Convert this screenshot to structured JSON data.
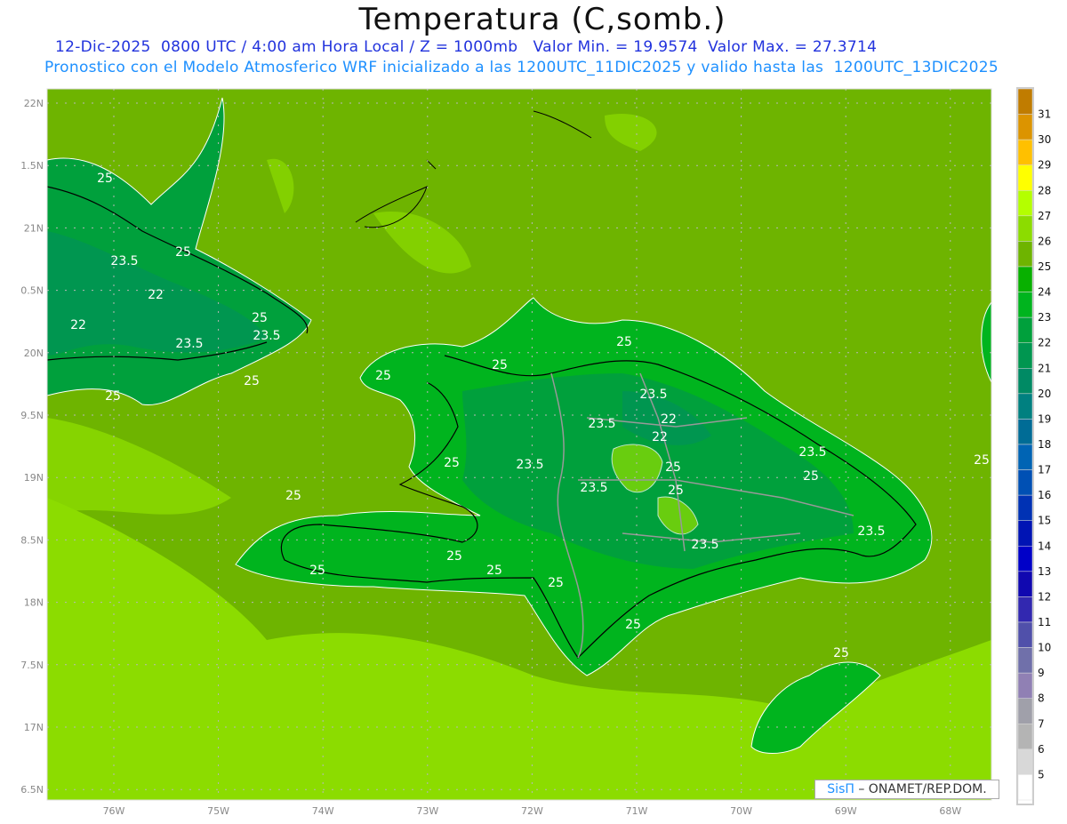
{
  "header": {
    "title": "Temperatura (C,somb.)",
    "line1": "12-Dic-2025  0800 UTC / 4:00 am Hora Local / Z = 1000mb   Valor Min. = 19.9574  Valor Max. = 27.3714",
    "line2": "Pronostico con el Modelo Atmosferico WRF inicializado a las 1200UTC_11DIC2025 y valido hasta las  1200UTC_13DIC2025"
  },
  "map": {
    "lat_labels": [
      "22N",
      "1.5N",
      "21N",
      "0.5N",
      "20N",
      "9.5N",
      "19N",
      "8.5N",
      "18N",
      "7.5N",
      "17N",
      "6.5N"
    ],
    "lon_labels": [
      "76W",
      "75W",
      "74W",
      "73W",
      "72W",
      "71W",
      "70W",
      "69W",
      "68W"
    ],
    "contour_labels": [
      "25",
      "25",
      "23.5",
      "25",
      "22",
      "22",
      "23.5",
      "23.5",
      "25",
      "25",
      "25",
      "25",
      "25",
      "23.5",
      "23.5",
      "22",
      "22",
      "23.5",
      "25",
      "25",
      "23.5",
      "25",
      "23.5",
      "25",
      "23.5",
      "25",
      "25",
      "23.5",
      "25",
      "25",
      "25",
      "25",
      "25",
      "25"
    ]
  },
  "colorbar": {
    "labels": [
      "31",
      "30",
      "29",
      "28",
      "27",
      "26",
      "25",
      "24",
      "23",
      "22",
      "21",
      "20",
      "19",
      "18",
      "17",
      "16",
      "15",
      "14",
      "13",
      "12",
      "11",
      "10",
      "9",
      "8",
      "7",
      "6",
      "5"
    ],
    "colors": [
      "#c07c00",
      "#dc9400",
      "#ffc000",
      "#ffff00",
      "#b4ff00",
      "#8cdc00",
      "#6eb400",
      "#08b000",
      "#00b41e",
      "#00a03c",
      "#009650",
      "#008a64",
      "#008080",
      "#006c96",
      "#0064b4",
      "#0050b4",
      "#0032b4",
      "#0014b4",
      "#0000c8",
      "#1008b0",
      "#3228b0",
      "#5050aa",
      "#7070aa",
      "#9080b4",
      "#a0a0aa",
      "#b4b4b4",
      "#d8d8d8",
      "#ffffff"
    ]
  },
  "credit": {
    "brand": "SisΠ",
    "text": " –  ONAMET/REP.DOM."
  }
}
